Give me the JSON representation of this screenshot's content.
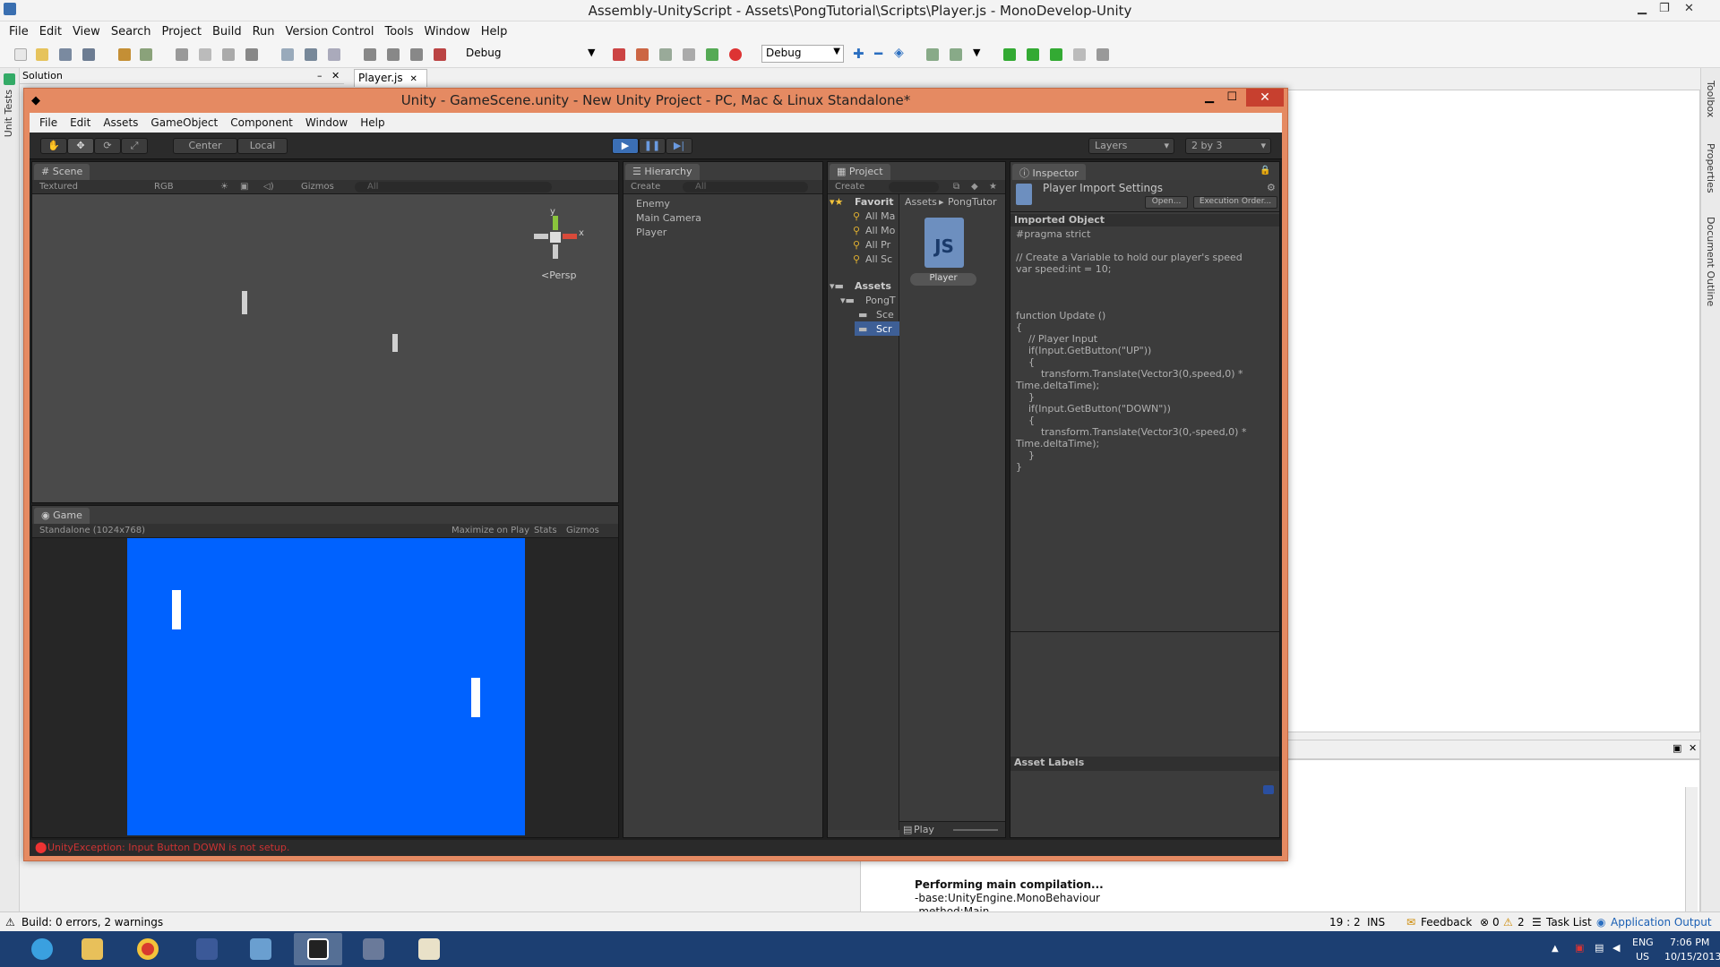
{
  "md": {
    "title": "Assembly-UnityScript - Assets\\PongTutorial\\Scripts\\Player.js - MonoDevelop-Unity",
    "menu": [
      "File",
      "Edit",
      "View",
      "Search",
      "Project",
      "Build",
      "Run",
      "Version Control",
      "Tools",
      "Window",
      "Help"
    ],
    "config_label": "Debug",
    "config_select": "Debug",
    "left_strip_label": "Unit Tests",
    "right_strip_labels": [
      "Toolbox",
      "Properties",
      "Document Outline"
    ],
    "solution_label": "Solution",
    "doc_tab": "Player.js",
    "output_lines": [
      "Performing main compilation...",
      "-base:UnityEngine.MonoBehaviour",
      "-method:Main"
    ],
    "status": {
      "build": "Build: 0 errors, 2 warnings",
      "position": "19 : 2",
      "mode": "INS",
      "feedback": "Feedback",
      "errors": "0",
      "warnings": "2",
      "task_list": "Task List",
      "app_output": "Application Output"
    }
  },
  "taskbar": {
    "apps": [
      "internet-explorer",
      "file-explorer",
      "chrome",
      "pidgin",
      "remote-desktop",
      "unity",
      "monodevelop",
      "paint"
    ],
    "lang": "ENG",
    "region": "US",
    "time": "7:06 PM",
    "date": "10/15/2013"
  },
  "unity": {
    "title": "Unity - GameScene.unity - New Unity Project - PC, Mac & Linux Standalone*",
    "menu": [
      "File",
      "Edit",
      "Assets",
      "GameObject",
      "Component",
      "Window",
      "Help"
    ],
    "toolbar": {
      "center": "Center",
      "local": "Local",
      "layers": "Layers",
      "layout": "2 by 3"
    },
    "scene": {
      "tab": "Scene",
      "shading": "Textured",
      "render_mode": "RGB",
      "gizmos": "Gizmos",
      "search": "All",
      "gizmo_y": "y",
      "gizmo_x": "x",
      "persp": "Persp"
    },
    "game": {
      "tab": "Game",
      "resolution": "Standalone (1024x768)",
      "maximize": "Maximize on Play",
      "stats": "Stats",
      "gizmos": "Gizmos",
      "background": "#0062ff"
    },
    "hierarchy": {
      "tab": "Hierarchy",
      "create": "Create",
      "search": "All",
      "items": [
        "Enemy",
        "Main Camera",
        "Player"
      ]
    },
    "project": {
      "tab": "Project",
      "create": "Create",
      "favorites_label": "Favorit",
      "favorites": [
        "All Ma",
        "All Mo",
        "All Pr",
        "All Sc"
      ],
      "assets_label": "Assets",
      "tree": [
        "PongT",
        "Sce",
        "Scr"
      ],
      "breadcrumb": [
        "Assets",
        "PongTutor"
      ],
      "file_badge": "JS",
      "file_name": "Player",
      "bottom_label": "Play"
    },
    "inspector": {
      "tab": "Inspector",
      "header": "Player Import Settings",
      "open": "Open...",
      "exec_order": "Execution Order...",
      "section": "Imported Object",
      "code": "#pragma strict\n\n// Create a Variable to hold our player's speed\nvar speed:int = 10;\n\n\n\nfunction Update ()\n{\n    // Player Input\n    if(Input.GetButton(\"UP\"))\n    {\n        transform.Translate(Vector3(0,speed,0) *\nTime.deltaTime);\n    }\n    if(Input.GetButton(\"DOWN\"))\n    {\n        transform.Translate(Vector3(0,-speed,0) *\nTime.deltaTime);\n    }\n}",
      "labels_section": "Asset Labels"
    },
    "console_error": "UnityException: Input Button DOWN is not setup."
  }
}
